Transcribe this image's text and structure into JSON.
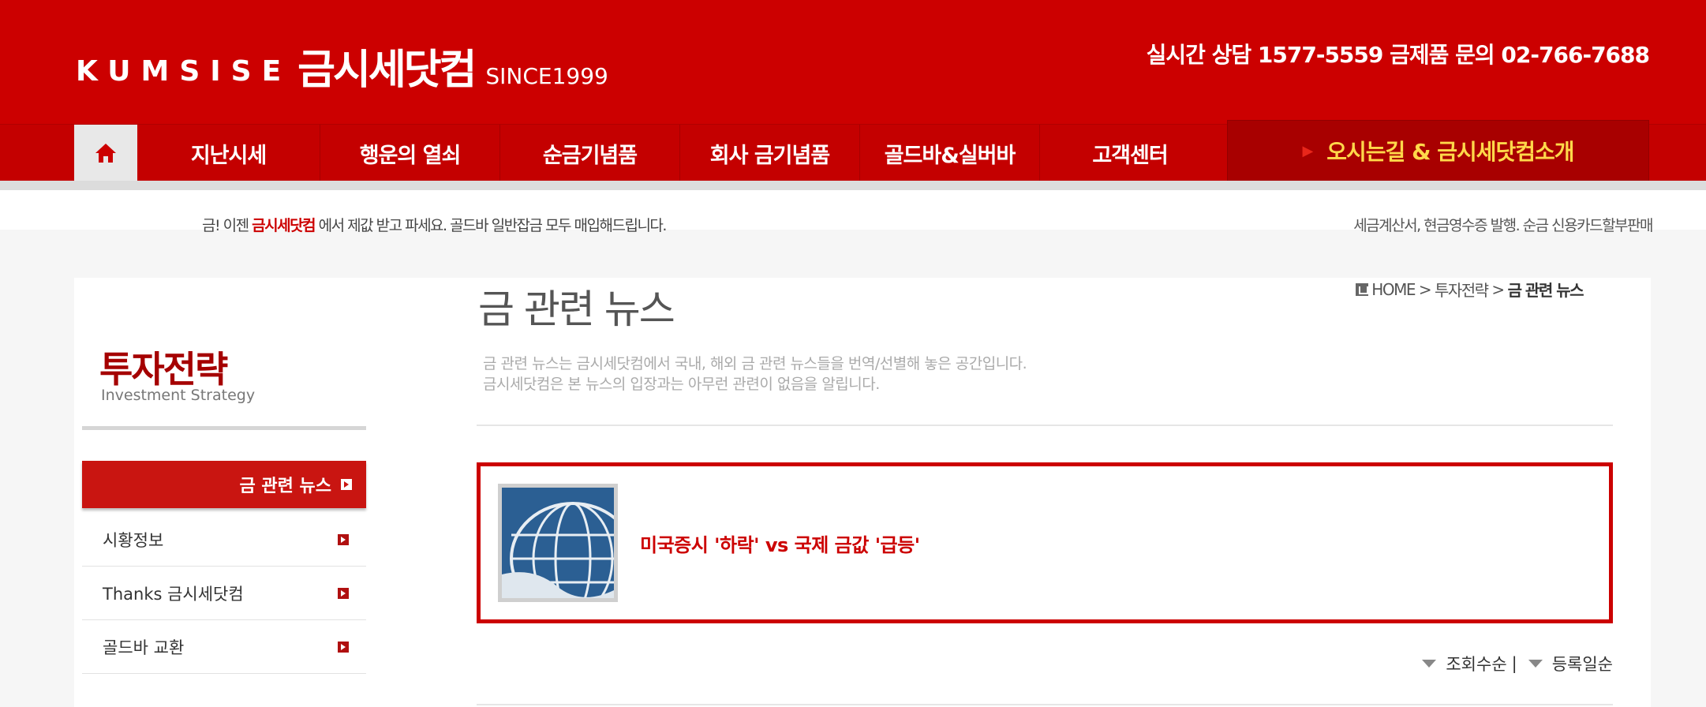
{
  "header": {
    "logo_en": "KUMSISE",
    "logo_ko": "금시세닷컴",
    "logo_since": "SINCE1999",
    "contact": "실시간 상담 1577-5559  금제품 문의 02-766-7688"
  },
  "nav": {
    "home_icon": "home-icon",
    "items": [
      {
        "label": "지난시세"
      },
      {
        "label": "행운의 열쇠"
      },
      {
        "label": "순금기념품"
      },
      {
        "label": "회사 금기념품"
      },
      {
        "label": "골드바&실버바"
      },
      {
        "label": "고객센터"
      }
    ],
    "intro": "오시는길 & 금시세닷컴소개"
  },
  "notice": {
    "left_prefix": "금! 이젠 ",
    "left_highlight": "금시세닷컴",
    "left_suffix": " 에서 제값 받고 파세요. 골드바 일반잡금 모두 매입해드립니다.",
    "right": "세금계산서, 현금영수증 발행. 순금 신용카드할부판매"
  },
  "sidebar": {
    "title": "투자전략",
    "subtitle": "Investment Strategy",
    "active": "금 관련 뉴스",
    "items": [
      {
        "label": "시황정보"
      },
      {
        "label": "Thanks 금시세닷컴"
      },
      {
        "label": "골드바 교환"
      }
    ]
  },
  "main": {
    "title": "금 관련 뉴스",
    "breadcrumb": {
      "home": "HOME",
      "sep": " > ",
      "parent": "투자전략",
      "current": "금 관련 뉴스"
    },
    "desc_line1": "금 관련 뉴스는 금시세닷컴에서 국내, 해외 금 관련 뉴스들을 번역/선별해 놓은 공간입니다.",
    "desc_line2": "금시세닷컴은 본 뉴스의 입장과는 아무런 관련이 없음을 알립니다.",
    "news": [
      {
        "title": "미국증시 '하락' vs 국제 금값 '급등'"
      }
    ],
    "sort": {
      "by_views": "조회수순",
      "sep": "|",
      "by_date": "등록일순"
    }
  },
  "colors": {
    "brand_red": "#cc0000",
    "nav_intro_text": "#ffd84a"
  }
}
